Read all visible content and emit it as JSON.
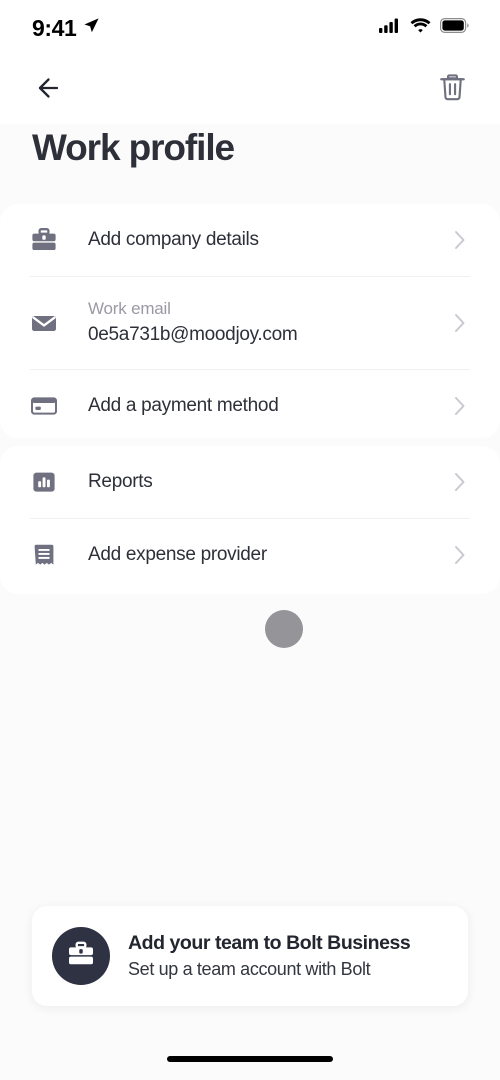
{
  "status_bar": {
    "time": "9:41",
    "location_icon": "location-arrow-icon",
    "cellular_icon": "cellular-signal-icon",
    "wifi_icon": "wifi-icon",
    "battery_icon": "battery-full-icon"
  },
  "nav": {
    "back_icon": "arrow-left-icon",
    "delete_icon": "trash-icon"
  },
  "header": {
    "title": "Work profile"
  },
  "groups": [
    {
      "name": "profile-details-group",
      "rows": [
        {
          "icon": "briefcase-icon",
          "label": "Add company details",
          "sub_label": "",
          "value": "",
          "chevron": "chevron-right-icon"
        },
        {
          "icon": "envelope-icon",
          "label": "",
          "sub_label": "Work email",
          "value": "0e5a731b@moodjoy.com",
          "chevron": "chevron-right-icon"
        },
        {
          "icon": "credit-card-icon",
          "label": "Add a payment method",
          "sub_label": "",
          "value": "",
          "chevron": "chevron-right-icon"
        }
      ]
    },
    {
      "name": "expenses-group",
      "rows": [
        {
          "icon": "bar-chart-icon",
          "label": "Reports",
          "sub_label": "",
          "value": "",
          "chevron": "chevron-right-icon"
        },
        {
          "icon": "receipt-icon",
          "label": "Add expense provider",
          "sub_label": "",
          "value": "",
          "chevron": "chevron-right-icon"
        }
      ]
    }
  ],
  "loading": {
    "spinner_name": "loading-spinner"
  },
  "promo": {
    "avatar_icon": "briefcase-icon",
    "title": "Add your team to Bolt Business",
    "subtitle": "Set up a team account with Bolt"
  },
  "colors": {
    "text_primary": "#2e3039",
    "text_muted": "#9a9aa5",
    "icon_gray": "#6f7080",
    "chevron": "#c9c9d1",
    "divider": "#f0f0f3",
    "page_bg": "#fbfbfc",
    "card_bg": "#ffffff",
    "avatar_bg": "#2f3242",
    "spinner": "#949499"
  }
}
